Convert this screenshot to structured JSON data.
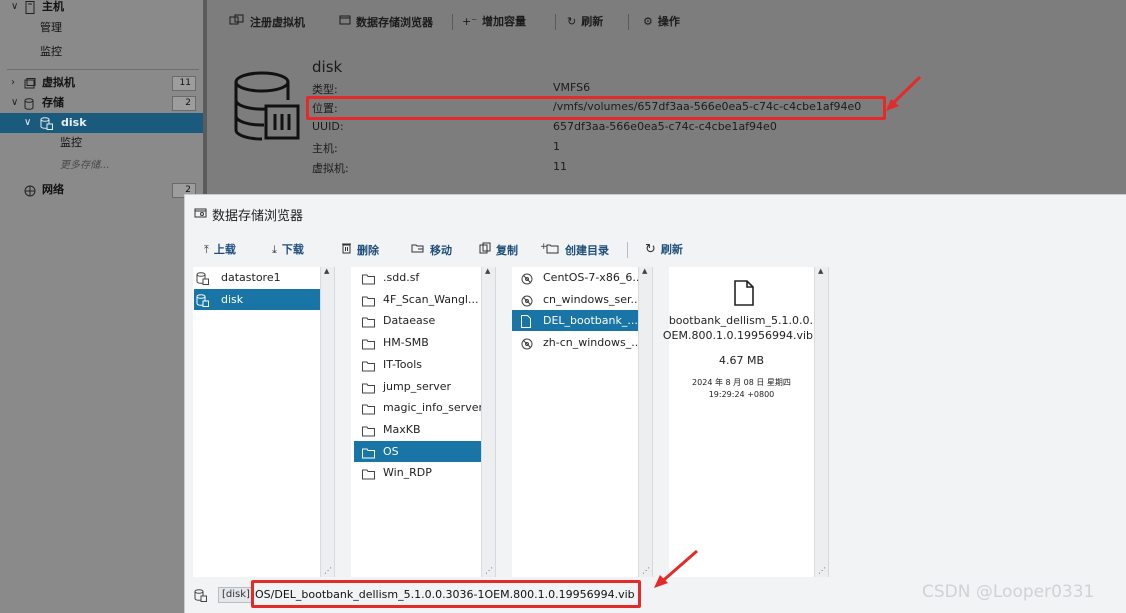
{
  "nav": {
    "host_label": "主机",
    "manage_label": "管理",
    "monitor_label": "监控",
    "vm_label": "虚拟机",
    "vm_count": "11",
    "storage_label": "存储",
    "storage_count": "2",
    "disk_label": "disk",
    "disk_monitor_label": "监控",
    "more_storage_label": "更多存储...",
    "network_label": "网络",
    "network_count": "2"
  },
  "toolbar": {
    "register_vm": "注册虚拟机",
    "datastore_browser": "数据存储浏览器",
    "increase_capacity": "增加容量",
    "refresh": "刷新",
    "actions": "操作"
  },
  "datastore": {
    "name": "disk",
    "type_label": "类型:",
    "type_value": "VMFS6",
    "location_label": "位置:",
    "location_value": "/vmfs/volumes/657df3aa-566e0ea5-c74c-c4cbe1af94e0",
    "uuid_label": "UUID:",
    "uuid_value": "657df3aa-566e0ea5-c74c-c4cbe1af94e0",
    "hosts_label": "主机:",
    "hosts_value": "1",
    "vms_label": "虚拟机:",
    "vms_value": "11"
  },
  "dialog": {
    "title": "数据存储浏览器",
    "toolbar": {
      "upload": "上载",
      "download": "下载",
      "delete": "删除",
      "move": "移动",
      "copy": "复制",
      "create_dir": "创建目录",
      "refresh": "刷新"
    },
    "datastores": [
      "datastore1",
      "disk"
    ],
    "folders": [
      ".sdd.sf",
      "4F_Scan_Wangl...",
      "Dataease",
      "HM-SMB",
      "IT-Tools",
      "jump_server",
      "magic_info_server",
      "MaxKB",
      "OS",
      "Win_RDP"
    ],
    "files": [
      "CentOS-7-x86_6...",
      "cn_windows_ser...",
      "DEL_bootbank_...",
      "zh-cn_windows_..."
    ],
    "preview": {
      "name_line1": "bootbank_dellism_5.1.0.0.",
      "name_line2": "OEM.800.1.0.19956994.vib",
      "size": "4.67 MB",
      "date": "2024 年 8 月 08 日 星期四",
      "time": "19:29:24 +0800"
    },
    "path_datastore": "[disk]",
    "path": "OS/DEL_bootbank_dellism_5.1.0.0.3036-1OEM.800.1.0.19956994.vib"
  },
  "watermark": "CSDN @Looper0331",
  "colors": {
    "selection": "#1875a6",
    "highlight": "#e52a2a",
    "nav_selection": "#1a5b7d"
  }
}
